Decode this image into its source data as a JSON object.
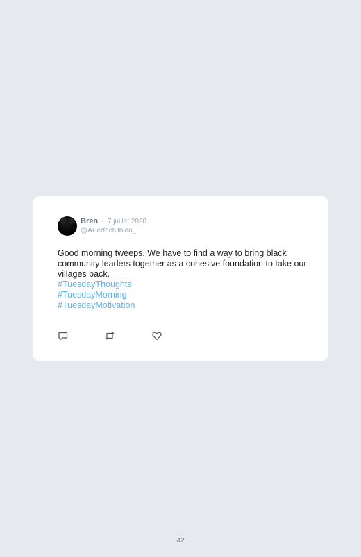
{
  "tweet": {
    "author_name": "Bren",
    "separator": "·",
    "date": "7 juillet 2020",
    "handle": "@APerfectUnion_",
    "text": "Good morning tweeps. We have to find a way to bring black community leaders together as a cohesive foundation to take our villages back.",
    "hashtags": [
      "#TuesdayThoughts",
      "#TuesdayMorning",
      "#TuesdayMotivation"
    ],
    "actions": [
      {
        "name": "reply",
        "icon": "reply-icon"
      },
      {
        "name": "retweet",
        "icon": "retweet-icon"
      },
      {
        "name": "like",
        "icon": "heart-icon"
      }
    ]
  },
  "page": {
    "number": "42"
  },
  "colors": {
    "background": "#e6e9ed",
    "card": "#ffffff",
    "hashtag": "#5fb4e6",
    "muted": "#9aa5b1"
  }
}
